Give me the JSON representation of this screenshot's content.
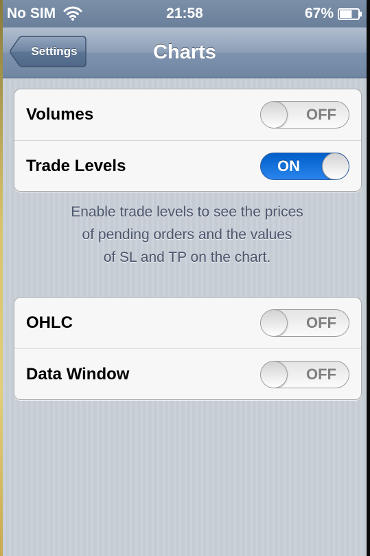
{
  "status_bar": {
    "carrier": "No SIM",
    "time": "21:58",
    "battery": "67%",
    "battery_level": 0.67,
    "icons": [
      "wifi-icon",
      "battery-icon"
    ]
  },
  "nav": {
    "back_label": "Settings",
    "title": "Charts"
  },
  "groups": [
    {
      "rows": [
        {
          "label": "Volumes",
          "state": "OFF"
        },
        {
          "label": "Trade Levels",
          "state": "ON"
        }
      ],
      "footer_lines": [
        "Enable trade levels to see the prices",
        "of pending orders and the values",
        "of SL and TP on the chart."
      ]
    },
    {
      "rows": [
        {
          "label": "OHLC",
          "state": "OFF"
        },
        {
          "label": "Data Window",
          "state": "OFF"
        }
      ]
    }
  ],
  "colors": {
    "switch_on": "#1a73e0",
    "nav_bar": "#7d92ad",
    "background": "#c5ccd4",
    "footer_text": "#4c566c"
  }
}
